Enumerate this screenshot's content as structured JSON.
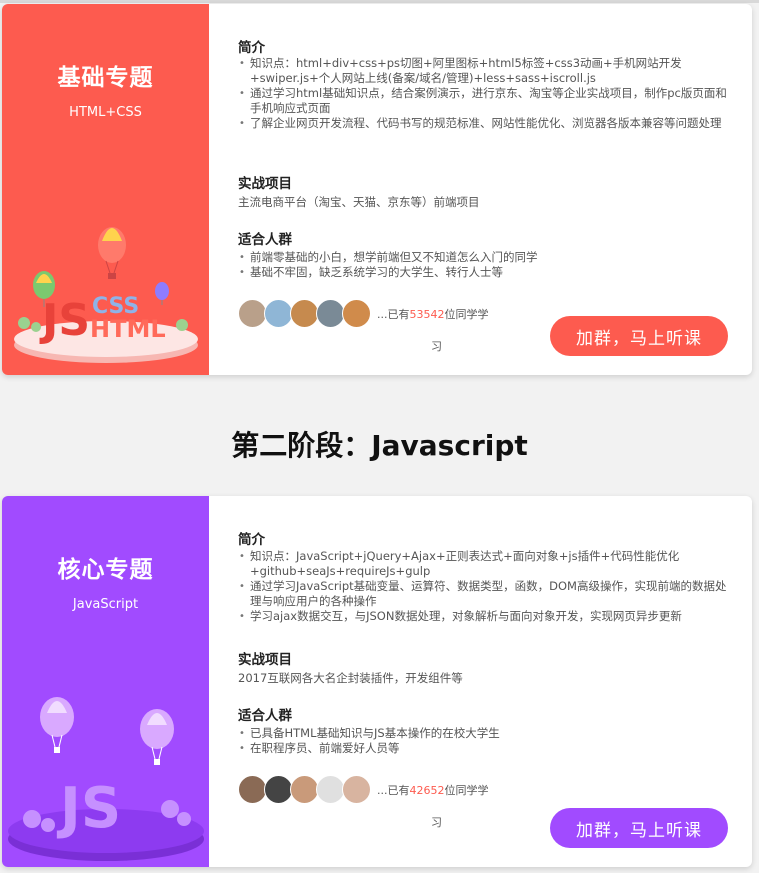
{
  "cards": [
    {
      "title": "基础专题",
      "subtitle": "HTML+CSS",
      "intro_heading": "简介",
      "intro_items": [
        "知识点：html+div+css+ps切图+阿里图标+html5标签+css3动画+手机网站开发+swiper.js+个人网站上线(备案/域名/管理)+less+sass+iscroll.js",
        "通过学习html基础知识点，结合案例演示，进行京东、淘宝等企业实战项目，制作pc版页面和手机响应式页面",
        "了解企业网页开发流程、代码书写的规范标准、网站性能优化、浏览器各版本兼容等问题处理"
      ],
      "project_heading": "实战项目",
      "project_text": "主流电商平台（淘宝、天猫、京东等）前端项目",
      "audience_heading": "适合人群",
      "audience_items": [
        "前端零基础的小白，想学前端但又不知道怎么入门的同学",
        "基础不牢固，缺乏系统学习的大学生、转行人士等"
      ],
      "students_prefix": "...已有",
      "students_count": "53542",
      "students_suffix": "位同学学",
      "students_tail": "习",
      "join_label": "加群，马上听课",
      "illustration_labels": [
        "JS",
        "CSS",
        "HTML"
      ]
    },
    {
      "title": "核心专题",
      "subtitle": "JavaScript",
      "intro_heading": "简介",
      "intro_items": [
        "知识点：JavaScript+jQuery+Ajax+正则表达式+面向对象+js插件+代码性能优化+github+seaJs+requireJs+gulp",
        "通过学习JavaScript基础变量、运算符、数据类型，函数，DOM高级操作，实现前端的数据处理与响应用户的各种操作",
        "学习ajax数据交互，与JSON数据处理，对象解析与面向对象开发，实现网页异步更新"
      ],
      "project_heading": "实战项目",
      "project_text": "2017互联网各大名企封装插件，开发组件等",
      "audience_heading": "适合人群",
      "audience_items": [
        "已具备HTML基础知识与JS基本操作的在校大学生",
        "在职程序员、前端爱好人员等"
      ],
      "students_prefix": "...已有",
      "students_count": "42652",
      "students_suffix": "位同学学",
      "students_tail": "习",
      "join_label": "加群，马上听课",
      "illustration_labels": [
        "JS"
      ]
    }
  ],
  "stage_heading": "第二阶段：Javascript",
  "colors": {
    "coral": "#fd5b4f",
    "purple": "#a14bff"
  }
}
